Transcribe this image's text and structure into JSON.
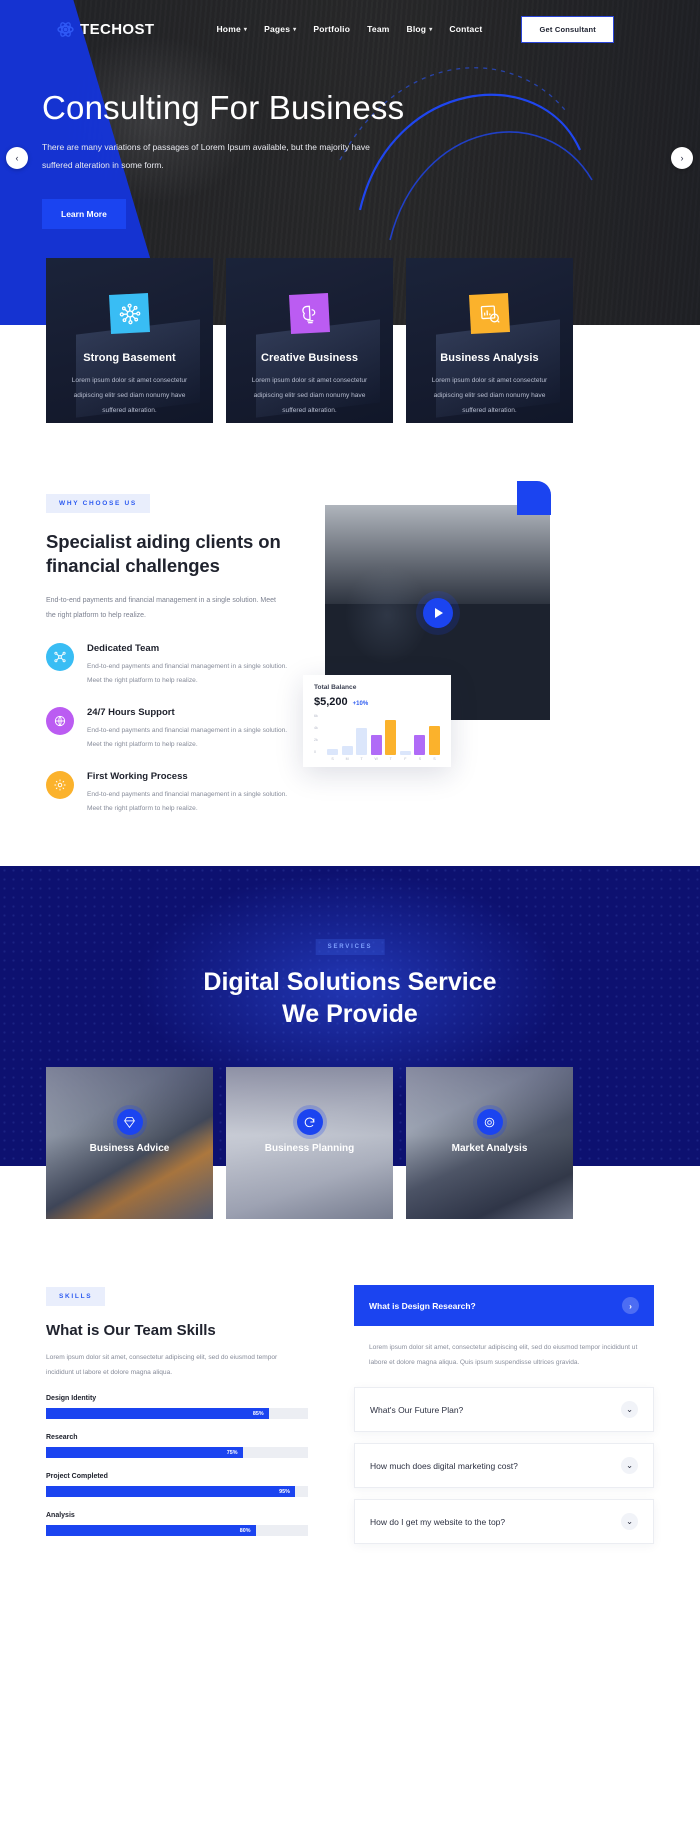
{
  "nav": {
    "brand": "TECHOST",
    "links": [
      {
        "label": "Home",
        "caret": true
      },
      {
        "label": "Pages",
        "caret": true
      },
      {
        "label": "Portfolio",
        "caret": false
      },
      {
        "label": "Team",
        "caret": false
      },
      {
        "label": "Blog",
        "caret": true
      },
      {
        "label": "Contact",
        "caret": false
      }
    ],
    "cta": "Get Consultant"
  },
  "hero": {
    "title": "Consulting For Business",
    "subtitle": "There are many variations of passages of Lorem Ipsum available, but the majority have suffered alteration in some form.",
    "button": "Learn More",
    "prev": "‹",
    "next": "›"
  },
  "feature_cards": [
    {
      "title": "Strong Basement",
      "desc": "Lorem ipsum dolor sit amet consectetur adipiscing elitr sed diam nonumy have suffered alteration.",
      "color": "#39bdf4",
      "icon": "network-icon"
    },
    {
      "title": "Creative Business",
      "desc": "Lorem ipsum dolor sit amet consectetur adipiscing elitr sed diam nonumy have suffered alteration.",
      "color": "#bb5cf2",
      "icon": "brain-idea-icon"
    },
    {
      "title": "Business Analysis",
      "desc": "Lorem ipsum dolor sit amet consectetur adipiscing elitr sed diam nonumy have suffered alteration.",
      "color": "#fbb22c",
      "icon": "chart-analysis-icon"
    }
  ],
  "why": {
    "pill": "WHY CHOOSE US",
    "title": "Specialist aiding clients on financial challenges",
    "desc": "End-to-end payments and financial management in a single solution. Meet the right platform to help realize.",
    "features": [
      {
        "title": "Dedicated Team",
        "desc": "End-to-end payments and financial management in a single solution. Meet the right platform to help realize.",
        "color": "#39bdf4",
        "icon": "team-nodes-icon"
      },
      {
        "title": "24/7 Hours Support",
        "desc": "End-to-end payments and financial management in a single solution. Meet the right platform to help realize.",
        "color": "#bb5cf2",
        "icon": "support-globe-icon"
      },
      {
        "title": "First Working Process",
        "desc": "End-to-end payments and financial management in a single solution. Meet the right platform to help realize.",
        "color": "#fbb22c",
        "icon": "gear-process-icon"
      }
    ],
    "play_button": "play-icon"
  },
  "chart_data": {
    "type": "bar",
    "title": "Total Balance",
    "value": "$5,200",
    "delta": "+10%",
    "categories": [
      "S",
      "M",
      "T",
      "W",
      "T",
      "F",
      "S",
      "S"
    ],
    "values": [
      900,
      1400,
      4200,
      3100,
      5600,
      700,
      3100,
      4600
    ],
    "colors": [
      "#dbe6fb",
      "#dbe6fb",
      "#dbe6fb",
      "#b06bf7",
      "#fbb22c",
      "#dbe6fb",
      "#b06bf7",
      "#fbb22c"
    ],
    "ylim": [
      0,
      6000
    ],
    "yticks": [
      "6k",
      "4k",
      "2k",
      "0"
    ],
    "xlabel": "",
    "ylabel": "",
    "grid": false,
    "legend": "none"
  },
  "services": {
    "pill": "SERVICES",
    "title_line1": "Digital Solutions Service",
    "title_line2": "We Provide",
    "cards": [
      {
        "label": "Business Advice",
        "icon": "diamond-icon"
      },
      {
        "label": "Business Planning",
        "icon": "refresh-icon"
      },
      {
        "label": "Market Analysis",
        "icon": "target-icon"
      }
    ]
  },
  "skills": {
    "pill": "SKILLS",
    "title": "What is Our Team Skills",
    "desc": "Lorem ipsum dolor sit amet, consectetur adipiscing elit, sed do eiusmod tempor incididunt ut labore et dolore magna aliqua.",
    "bars": [
      {
        "label": "Design Identity",
        "value": "85%",
        "pct": 85
      },
      {
        "label": "Research",
        "value": "75%",
        "pct": 75
      },
      {
        "label": "Project Completed",
        "value": "95%",
        "pct": 95
      },
      {
        "label": "Analysis",
        "value": "80%",
        "pct": 80
      }
    ]
  },
  "faq": {
    "open": {
      "question": "What is Design Research?",
      "answer": "Lorem ipsum dolor sit amet, consectetur adipiscing elit, sed do eiusmod tempor incididunt ut labore et dolore magna aliqua. Quis ipsum suspendisse ultrices gravida.",
      "toggle": "›"
    },
    "items": [
      {
        "question": "What's Our Future Plan?",
        "toggle": "⌄"
      },
      {
        "question": "How much does digital marketing cost?",
        "toggle": "⌄"
      },
      {
        "question": "How do I get my website to the top?",
        "toggle": "⌄"
      }
    ]
  }
}
